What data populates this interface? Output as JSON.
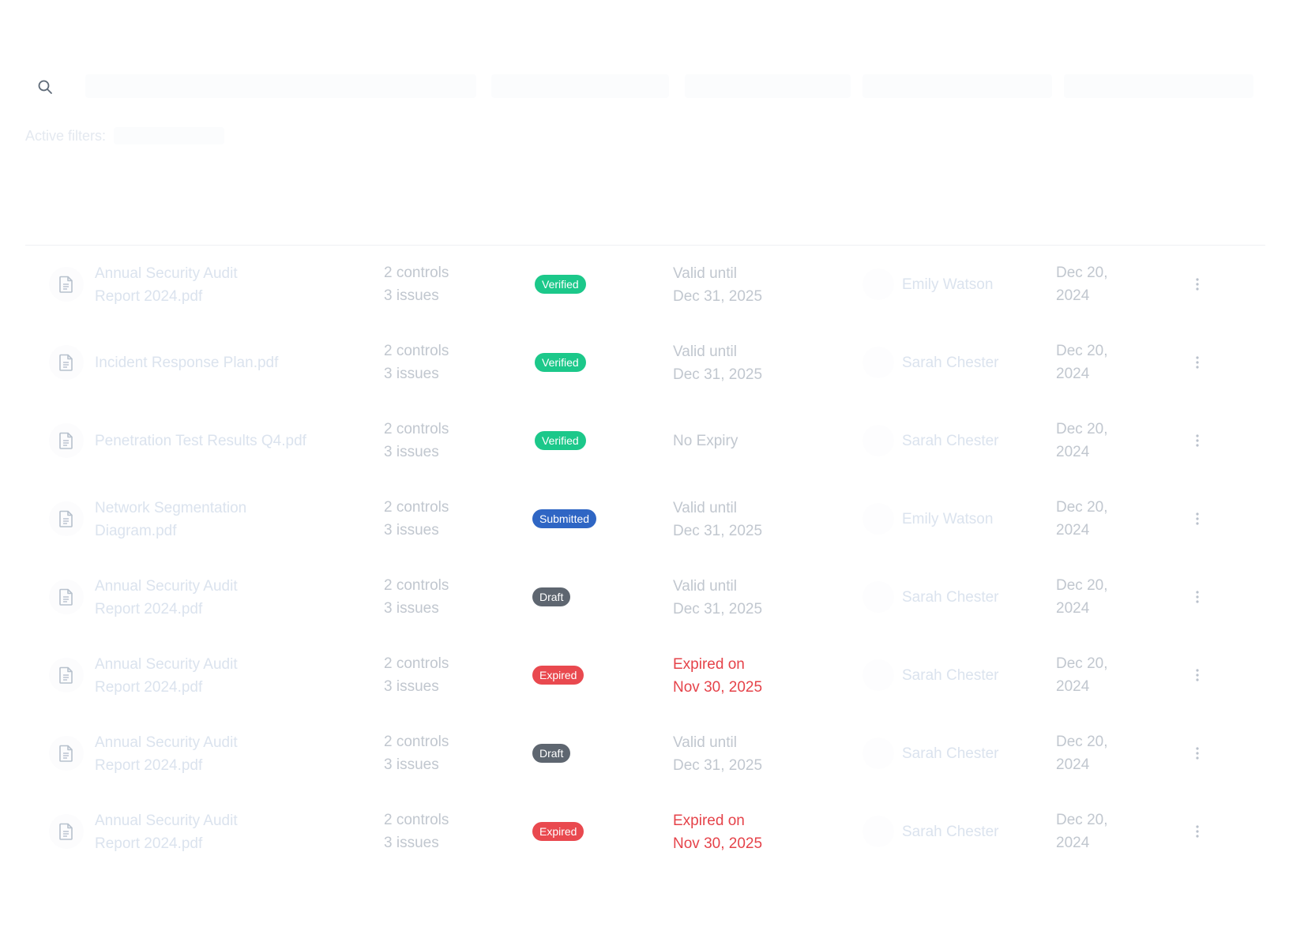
{
  "filters": {
    "label": "Active filters:"
  },
  "colors": {
    "verified": "#1cc88a",
    "submitted": "#2f66c4",
    "draft": "#5e6670",
    "expired": "#e9494f",
    "expired_text": "#e5434a",
    "muted_text": "#c1c7cf",
    "ghost_text": "#dbe3ee"
  },
  "icons": {
    "search": "search-icon",
    "file": "file-text-icon",
    "menu": "more-vertical-icon"
  },
  "rows": [
    {
      "file_lines": [
        "Annual Security Audit",
        "Report 2024.pdf"
      ],
      "controls": "2 controls",
      "issues": "3 issues",
      "status": "Verified",
      "status_type": "verified",
      "validity_lines": [
        "Valid until",
        "Dec 31, 2025"
      ],
      "validity_type": "normal",
      "owner": "Emily Watson",
      "date_lines": [
        "Dec 20,",
        "2024"
      ]
    },
    {
      "file_lines": [
        "Incident Response Plan.pdf"
      ],
      "controls": "2 controls",
      "issues": "3 issues",
      "status": "Verified",
      "status_type": "verified",
      "validity_lines": [
        "Valid until",
        "Dec 31, 2025"
      ],
      "validity_type": "normal",
      "owner": "Sarah Chester",
      "date_lines": [
        "Dec 20,",
        "2024"
      ]
    },
    {
      "file_lines": [
        "Penetration Test Results Q4.pdf"
      ],
      "controls": "2 controls",
      "issues": "3 issues",
      "status": "Verified",
      "status_type": "verified",
      "validity_lines": [
        "No Expiry"
      ],
      "validity_type": "normal",
      "owner": "Sarah Chester",
      "date_lines": [
        "Dec 20,",
        "2024"
      ]
    },
    {
      "file_lines": [
        "Network Segmentation",
        "Diagram.pdf"
      ],
      "controls": "2 controls",
      "issues": "3 issues",
      "status": "Submitted",
      "status_type": "submitted",
      "validity_lines": [
        "Valid until",
        "Dec 31, 2025"
      ],
      "validity_type": "normal",
      "owner": "Emily Watson",
      "date_lines": [
        "Dec 20,",
        "2024"
      ]
    },
    {
      "file_lines": [
        "Annual Security Audit",
        "Report 2024.pdf"
      ],
      "controls": "2 controls",
      "issues": "3 issues",
      "status": "Draft",
      "status_type": "draft",
      "validity_lines": [
        "Valid until",
        "Dec 31, 2025"
      ],
      "validity_type": "normal",
      "owner": "Sarah Chester",
      "date_lines": [
        "Dec 20,",
        "2024"
      ]
    },
    {
      "file_lines": [
        "Annual Security Audit",
        "Report 2024.pdf"
      ],
      "controls": "2 controls",
      "issues": "3 issues",
      "status": "Expired",
      "status_type": "expired",
      "validity_lines": [
        "Expired on",
        "Nov 30, 2025"
      ],
      "validity_type": "expired",
      "owner": "Sarah Chester",
      "date_lines": [
        "Dec 20,",
        "2024"
      ]
    },
    {
      "file_lines": [
        "Annual Security Audit",
        "Report 2024.pdf"
      ],
      "controls": "2 controls",
      "issues": "3 issues",
      "status": "Draft",
      "status_type": "draft",
      "validity_lines": [
        "Valid until",
        "Dec 31, 2025"
      ],
      "validity_type": "normal",
      "owner": "Sarah Chester",
      "date_lines": [
        "Dec 20,",
        "2024"
      ]
    },
    {
      "file_lines": [
        "Annual Security Audit",
        "Report 2024.pdf"
      ],
      "controls": "2 controls",
      "issues": "3 issues",
      "status": "Expired",
      "status_type": "expired",
      "validity_lines": [
        "Expired on",
        "Nov 30, 2025"
      ],
      "validity_type": "expired",
      "owner": "Sarah Chester",
      "date_lines": [
        "Dec 20,",
        "2024"
      ]
    }
  ]
}
